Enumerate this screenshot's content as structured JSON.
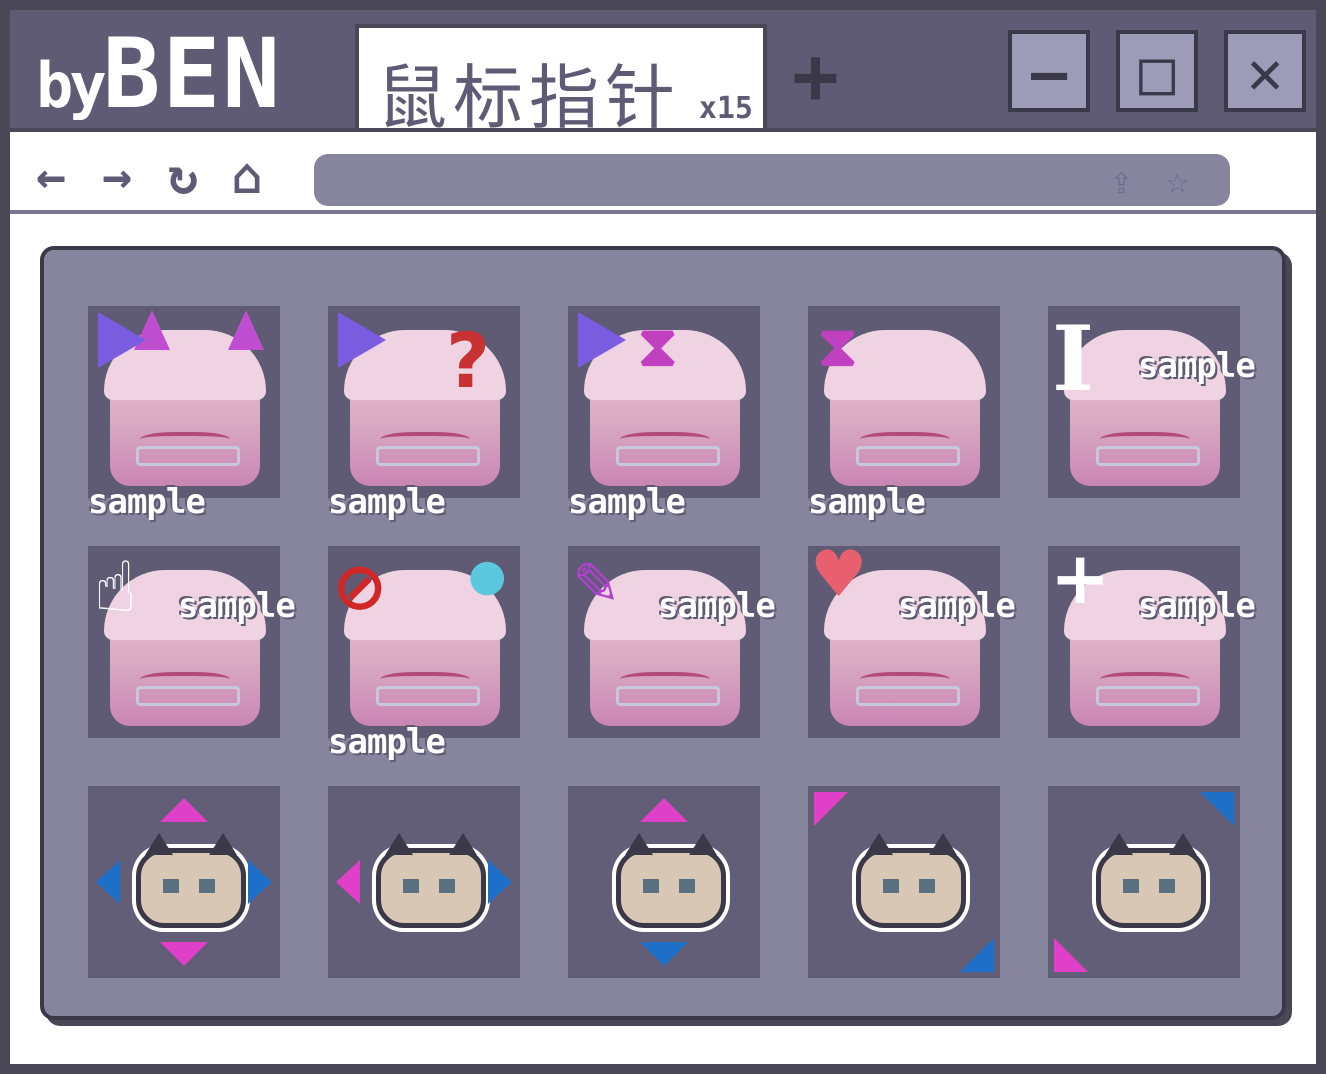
{
  "titlebar": {
    "brand_small": "by",
    "brand_big": "BEN"
  },
  "tab": {
    "title": "鼠标指针",
    "count": "x15"
  },
  "newtab_label": "+",
  "window_buttons": {
    "minimize": "—",
    "maximize": "□",
    "close": "✕"
  },
  "nav": {
    "back": "←",
    "forward": "→",
    "reload": "↻",
    "home": "⌂"
  },
  "address": {
    "share_icon": "share-icon",
    "star_icon": "☆"
  },
  "colors": {
    "frame": "#4a4757",
    "titlebar": "#5f5b74",
    "panel": "#87849e",
    "pink": "#e040c8",
    "blue": "#1e6fc8"
  },
  "tiles": {
    "sample_text": "sample",
    "row1": [
      "normal",
      "help",
      "working",
      "busy",
      "text"
    ],
    "row2": [
      "link",
      "unavailable",
      "handwriting",
      "person",
      "precision"
    ],
    "row3": [
      "move",
      "horizontal-resize",
      "vertical-resize",
      "diagonal-resize-1",
      "diagonal-resize-2"
    ]
  },
  "overlays": {
    "help": "?",
    "unavailable": "⊘",
    "water": "💧",
    "heart": "♥",
    "crosshair": "+",
    "ibeam": "I",
    "hand": "☝"
  }
}
